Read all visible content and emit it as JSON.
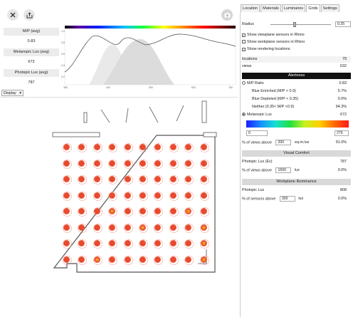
{
  "toolbar": {
    "close_icon": "close-icon",
    "export_icon": "export-icon",
    "camera_icon": "camera-icon"
  },
  "stats": [
    {
      "label": "M/P (avg)",
      "value": "0.83"
    },
    {
      "label": "Melanopic Lux (avg)",
      "value": "672"
    },
    {
      "label": "Photopic Lux (avg)",
      "value": "787"
    }
  ],
  "spectrum_chart": {
    "x_ticks": [
      "380",
      "400",
      "500",
      "600",
      "780"
    ],
    "y_ticks": [
      "1.0",
      "0.8",
      "0.6",
      "0.4",
      "0.2"
    ]
  },
  "display": {
    "label": "Display",
    "dropdown": "▾"
  },
  "tabs": [
    "Location",
    "Materials",
    "Luminaires",
    "Grids",
    "Settings"
  ],
  "active_tab": "Grids",
  "grids": {
    "radius_label": "Radius",
    "radius_value": "0.25",
    "radius_fraction": 0.4,
    "checks": [
      {
        "label": "Show viewplane sensors in Rhino",
        "checked": true
      },
      {
        "label": "Show workplane sensors in Rhino",
        "checked": false
      },
      {
        "label": "Show rendering locations",
        "checked": true
      }
    ],
    "locations_label": "locations",
    "locations_value": "79",
    "views_label": "views",
    "views_value": "632"
  },
  "alertness": {
    "title": "Alertness",
    "mp_ratio_label": "M/P Ratio",
    "mp_ratio_value": "0.83",
    "blue_enriched_label": "Blue Enriched (M/P > 0.9)",
    "blue_enriched_value": "5.7%",
    "blue_depleted_label": "Blue Depleted (M/P < 0.35)",
    "blue_depleted_value": "0.0%",
    "neither_label": "Neither (0.35< M/P <0.9)",
    "neither_value": "94.3%",
    "melanopic_label": "Melanopic Lux",
    "melanopic_value": "672",
    "scale_min": "0",
    "scale_max": "275",
    "views_above_label": "% of views above",
    "views_above_input": "200",
    "views_above_unit": "eq.m.lux",
    "views_above_value": "91.0%"
  },
  "visual_comfort": {
    "title": "Visual Comfort",
    "photopic_label": "Photopic Lux (Ev)",
    "photopic_value": "787",
    "views_above_label": "% of views above",
    "views_above_input": "1500",
    "views_above_unit": "lux",
    "views_above_value": "0.0%"
  },
  "workplane": {
    "title": "Workplane Illuminance",
    "photopic_label": "Photopic Lux",
    "photopic_value": "808",
    "sensors_above_label": "% of sensors above",
    "sensors_above_input": "300",
    "sensors_above_unit": "lux",
    "sensors_above_value": "0.0%"
  },
  "sensor_grid": {
    "rows": 8,
    "cols": 10,
    "color": "#e74a2f"
  }
}
